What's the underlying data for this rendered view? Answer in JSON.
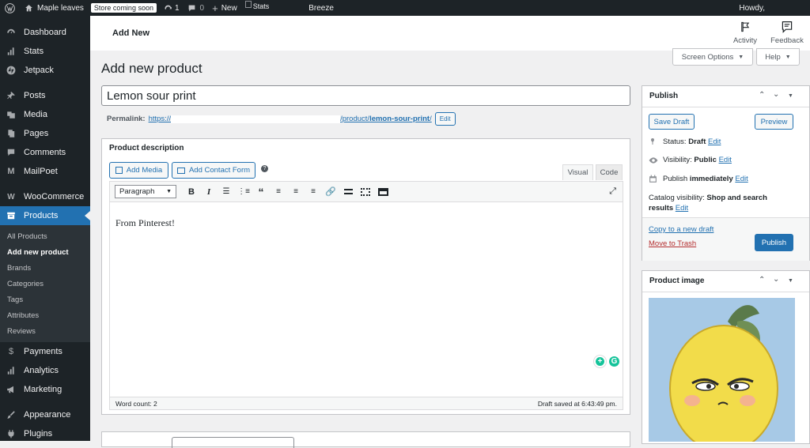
{
  "adminbar": {
    "site_name": "Maple leaves",
    "store_badge": "Store coming soon",
    "updates_count": "1",
    "comments_count": "0",
    "new_label": "New",
    "stats_label": "Stats",
    "breeze_label": "Breeze",
    "howdy": "Howdy,"
  },
  "sidebar": {
    "items_top": [
      "Dashboard",
      "Stats",
      "Jetpack",
      "Posts",
      "Media",
      "Pages",
      "Comments",
      "MailPoet",
      "WooCommerce",
      "Products"
    ],
    "subitems": [
      "All Products",
      "Add new product",
      "Brands",
      "Categories",
      "Tags",
      "Attributes",
      "Reviews"
    ],
    "items_bottom": [
      "Payments",
      "Analytics",
      "Marketing",
      "Appearance",
      "Plugins"
    ]
  },
  "topbar": {
    "title": "Add New",
    "activity": "Activity",
    "feedback": "Feedback"
  },
  "screen_options": "Screen Options",
  "help": "Help",
  "page_title": "Add new product",
  "product": {
    "title": "Lemon sour print",
    "permalink_label": "Permalink:",
    "permalink_prefix": "https://",
    "permalink_path": "/product/",
    "permalink_slug": "lemon-sour-print",
    "permalink_suffix": "/",
    "edit_label": "Edit"
  },
  "editor": {
    "box_title": "Product description",
    "add_media": "Add Media",
    "add_contact_form": "Add Contact Form",
    "tab_visual": "Visual",
    "tab_code": "Code",
    "format": "Paragraph",
    "content": "From Pinterest!",
    "word_count": "Word count: 2",
    "draft_saved": "Draft saved at 6:43:49 pm."
  },
  "publish": {
    "title": "Publish",
    "save_draft": "Save Draft",
    "preview": "Preview",
    "status_label": "Status:",
    "status_value": "Draft",
    "visibility_label": "Visibility:",
    "visibility_value": "Public",
    "publish_label": "Publish",
    "publish_value": "immediately",
    "catalog_label": "Catalog visibility:",
    "catalog_value_1": "Shop and search",
    "catalog_value_2": "results",
    "edit": "Edit",
    "copy_draft": "Copy to a new draft",
    "move_trash": "Move to Trash",
    "publish_button": "Publish"
  },
  "product_image": {
    "title": "Product image"
  },
  "colors": {
    "accent": "#2271b1",
    "adminbar": "#1d2327",
    "trash": "#b32d2e"
  }
}
